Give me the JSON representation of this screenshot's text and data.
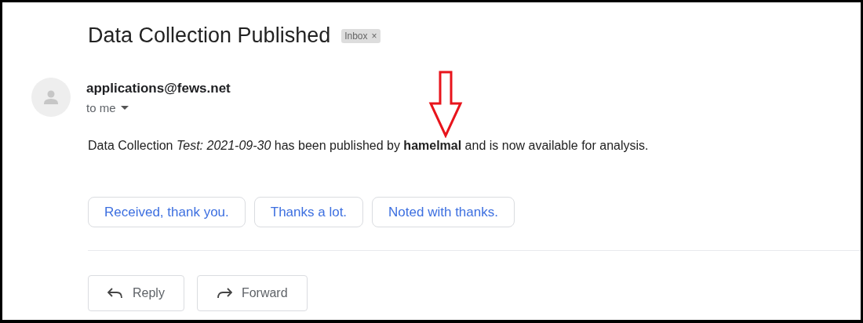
{
  "subject": "Data Collection Published",
  "label": {
    "text": "Inbox",
    "close": "×"
  },
  "sender": {
    "email": "applications@fews.net",
    "recipient": "to me"
  },
  "body": "Data Collection *Test: 2021-09-30* has been published by **hamelmal** and is now available for analysis.",
  "smart_replies": [
    "Received, thank you.",
    "Thanks a lot.",
    "Noted with thanks."
  ],
  "actions": [
    {
      "kind": "reply",
      "label": "Reply"
    },
    {
      "kind": "forward",
      "label": "Forward"
    }
  ]
}
